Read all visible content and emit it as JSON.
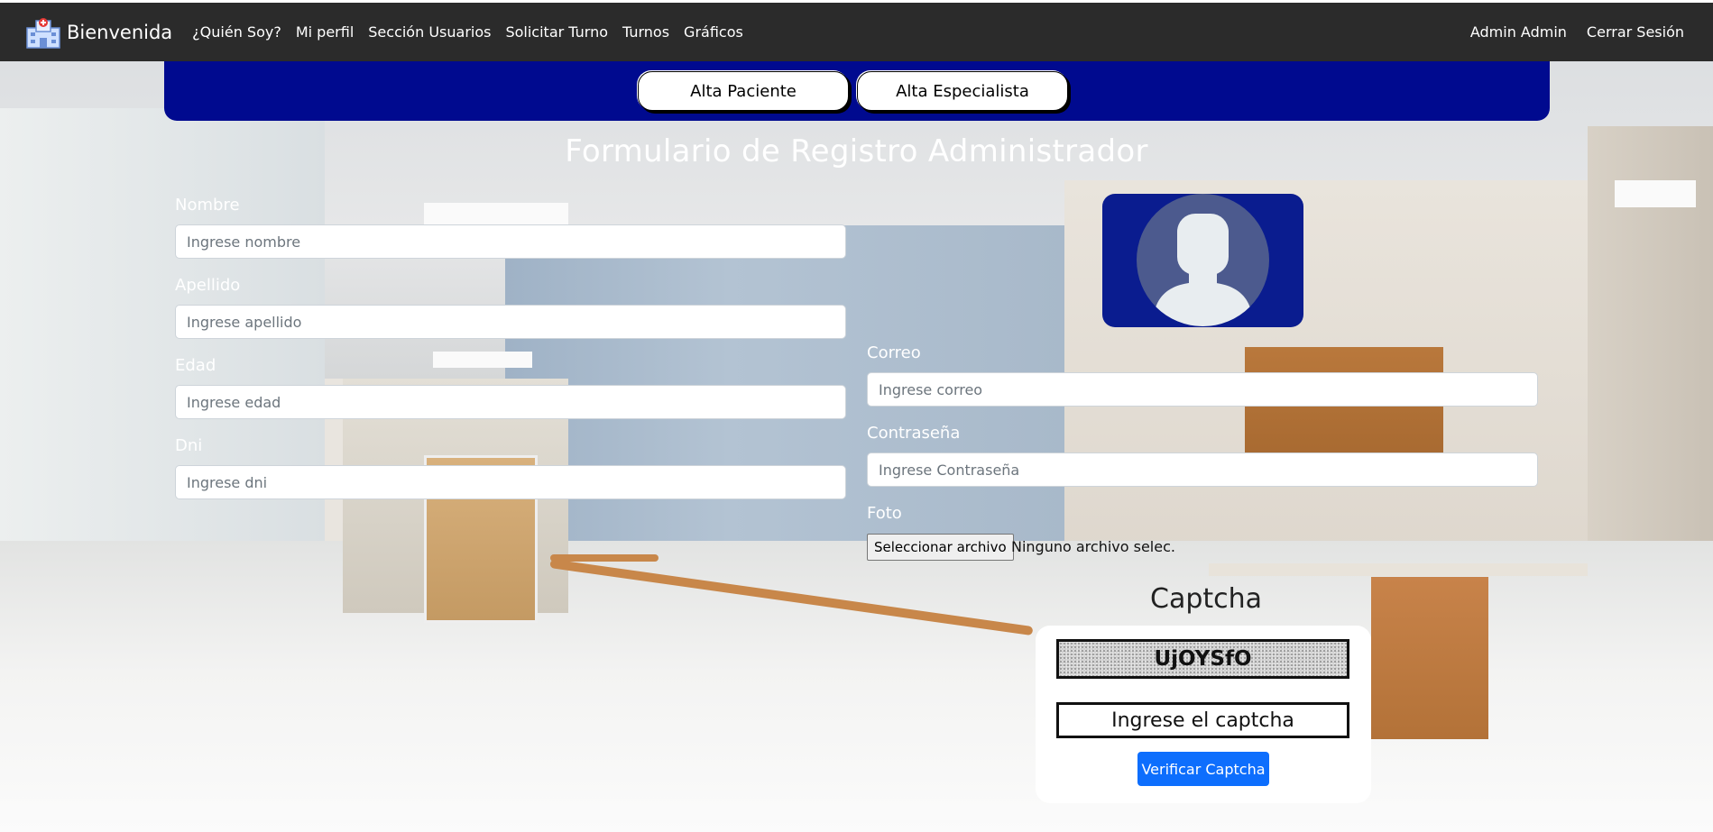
{
  "navbar": {
    "brand": "Bienvenida",
    "links": [
      "¿Quién Soy?",
      "Mi perfil",
      "Sección Usuarios",
      "Solicitar Turno",
      "Turnos",
      "Gráficos"
    ],
    "user": "Admin Admin",
    "logout": "Cerrar Sesión"
  },
  "band": {
    "btn_paciente": "Alta Paciente",
    "btn_especialista": "Alta Especialista",
    "color": "#000a8f"
  },
  "form": {
    "title": "Formulario de Registro Administrador",
    "nombre": {
      "label": "Nombre",
      "placeholder": "Ingrese nombre"
    },
    "apellido": {
      "label": "Apellido",
      "placeholder": "Ingrese apellido"
    },
    "edad": {
      "label": "Edad",
      "placeholder": "Ingrese edad"
    },
    "dni": {
      "label": "Dni",
      "placeholder": "Ingrese dni"
    },
    "correo": {
      "label": "Correo",
      "placeholder": "Ingrese correo"
    },
    "contrasena": {
      "label": "Contraseña",
      "placeholder": "Ingrese Contraseña"
    },
    "foto": {
      "label": "Foto",
      "button": "Seleccionar archivo",
      "status": "Ninguno archivo selec."
    }
  },
  "captcha": {
    "title": "Captcha",
    "code": "UjOYSfO",
    "placeholder": "Ingrese el captcha",
    "verify": "Verificar Captcha",
    "verify_color": "#0d6efd"
  },
  "icons": {
    "brand": "hospital-icon",
    "avatar": "user-silhouette-icon"
  }
}
